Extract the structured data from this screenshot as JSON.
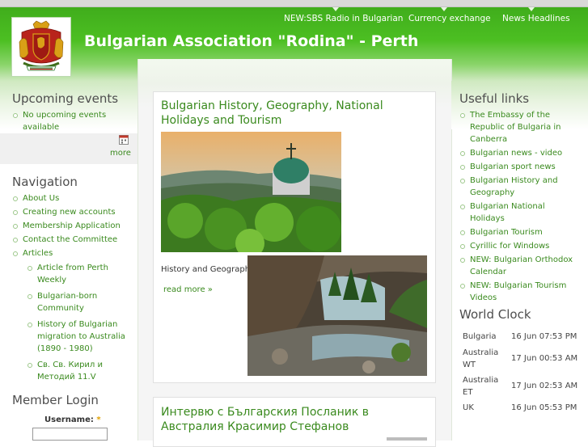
{
  "site": {
    "title": "Bulgarian Association \"Rodina\" - Perth"
  },
  "primary_links": [
    {
      "label": "NEW:SBS Radio in Bulgarian"
    },
    {
      "label": "Currency exchange"
    },
    {
      "label": "News Headlines"
    }
  ],
  "upcoming_events": {
    "title": "Upcoming events",
    "empty_text": "No upcoming events available",
    "more_label": "more",
    "icon": "ical-calendar-icon"
  },
  "navigation": {
    "title": "Navigation",
    "items": [
      {
        "label": "About Us"
      },
      {
        "label": "Creating new accounts"
      },
      {
        "label": "Membership Application"
      },
      {
        "label": "Contact the Committee"
      },
      {
        "label": "Articles"
      }
    ],
    "sub_items": [
      {
        "label": "Article from Perth Weekly"
      },
      {
        "label": "Bulgarian-born Community"
      },
      {
        "label": "History of Bulgarian migration to Australia (1890 - 1980)"
      },
      {
        "label": "Св. Св. Кирил и Методий 11.V"
      }
    ]
  },
  "member_login": {
    "title": "Member Login",
    "username_label": "Username:",
    "required_marker": "*"
  },
  "articles": [
    {
      "title": "Bulgarian History, Geography, National Holidays and Tourism",
      "body_text": "History and Geography",
      "read_more": "read more »",
      "image1": "monastery-photo",
      "image2": "canyon-river-photo"
    },
    {
      "title": "Интервю с Българския Посланик в Австралия Красимир Стефанов"
    }
  ],
  "useful_links": {
    "title": "Useful links",
    "items": [
      {
        "label": "The Embassy of the Republic of Bulgaria in Canberra"
      },
      {
        "label": "Bulgarian news - video"
      },
      {
        "label": "Bulgarian sport news"
      },
      {
        "label": "Bulgarian History and Geography"
      },
      {
        "label": "Bulgarian National Holidays"
      },
      {
        "label": "Bulgarian Tourism"
      },
      {
        "label": "Cyrillic for Windows"
      },
      {
        "label": "NEW: Bulgarian Orthodox Calendar"
      },
      {
        "label": "NEW: Bulgarian Tourism Videos"
      }
    ]
  },
  "world_clock": {
    "title": "World Clock",
    "rows": [
      {
        "place": "Bulgaria",
        "time": "16 Jun 07:53 PM"
      },
      {
        "place": "Australia WT",
        "time": "17 Jun 00:53 AM"
      },
      {
        "place": "Australia ET",
        "time": "17 Jun 02:53 AM"
      },
      {
        "place": "UK",
        "time": "16 Jun 05:53 PM"
      }
    ]
  },
  "colors": {
    "header_green": "#4cbf22",
    "link_green": "#3a8a1e",
    "required_star": "#e0a000"
  }
}
